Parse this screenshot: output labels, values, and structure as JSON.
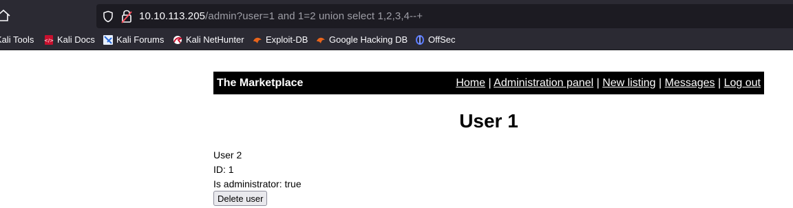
{
  "browser": {
    "url_host": "10.10.113.205",
    "url_path": "/admin?user=1 and 1=2 union select 1,2,3,4--+"
  },
  "bookmarks": [
    {
      "label": "Kali Tools",
      "icon": "kali-tools-icon"
    },
    {
      "label": "Kali Docs",
      "icon": "kali-docs-icon"
    },
    {
      "label": "Kali Forums",
      "icon": "kali-forums-icon"
    },
    {
      "label": "Kali NetHunter",
      "icon": "kali-nethunter-icon"
    },
    {
      "label": "Exploit-DB",
      "icon": "exploit-db-icon"
    },
    {
      "label": "Google Hacking DB",
      "icon": "google-hacking-db-icon"
    },
    {
      "label": "OffSec",
      "icon": "offsec-icon"
    }
  ],
  "site": {
    "title": "The Marketplace",
    "nav": [
      "Home",
      "Administration panel",
      "New listing",
      "Messages",
      "Log out"
    ],
    "separator": "|"
  },
  "page": {
    "heading": "User 1",
    "username": "User 2",
    "id_line": "ID: 1",
    "admin_line": "Is administrator: true",
    "delete_button": "Delete user"
  },
  "colors": {
    "toolbar_bg": "#2b2a33",
    "urlbar_bg": "#1c1b22",
    "header_bg": "#000000"
  }
}
